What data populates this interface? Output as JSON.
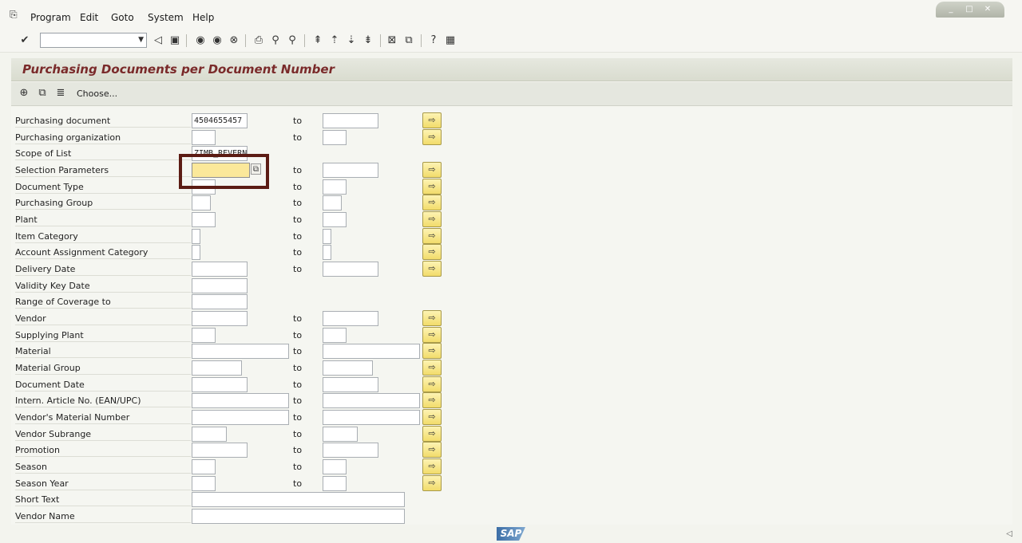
{
  "menu": {
    "items": [
      "Program",
      "Edit",
      "Goto",
      "System",
      "Help"
    ]
  },
  "window_controls": [
    "_",
    "□",
    "✕"
  ],
  "toolbar": {
    "command_field_value": ""
  },
  "screen": {
    "title": "Purchasing Documents per Document Number",
    "choose_label": "Choose..."
  },
  "fields": [
    {
      "label": "Purchasing document",
      "low": "4504655457",
      "to": "to",
      "high": "",
      "more": true
    },
    {
      "label": "Purchasing organization",
      "low": "",
      "to": "to",
      "high": "",
      "more": true
    },
    {
      "label": "Scope of List",
      "low": "ZIMB_REVERN",
      "to": "",
      "high": "",
      "more": false
    },
    {
      "label": "Selection Parameters",
      "low": "",
      "to": "to",
      "high": "",
      "more": true
    },
    {
      "label": "Document Type",
      "low": "",
      "to": "to",
      "high": "",
      "more": true
    },
    {
      "label": "Purchasing Group",
      "low": "",
      "to": "to",
      "high": "",
      "more": true
    },
    {
      "label": "Plant",
      "low": "",
      "to": "to",
      "high": "",
      "more": true
    },
    {
      "label": "Item Category",
      "low": "",
      "to": "to",
      "high": "",
      "more": true
    },
    {
      "label": "Account Assignment Category",
      "low": "",
      "to": "to",
      "high": "",
      "more": true
    },
    {
      "label": "Delivery Date",
      "low": "",
      "to": "to",
      "high": "",
      "more": true
    },
    {
      "label": "Validity Key Date",
      "low": "",
      "to": "",
      "high": "",
      "more": false
    },
    {
      "label": "Range of Coverage to",
      "low": "",
      "to": "",
      "high": "",
      "more": false
    },
    {
      "label": "Vendor",
      "low": "",
      "to": "to",
      "high": "",
      "more": true
    },
    {
      "label": "Supplying Plant",
      "low": "",
      "to": "to",
      "high": "",
      "more": true
    },
    {
      "label": "Material",
      "low": "",
      "to": "to",
      "high": "",
      "more": true
    },
    {
      "label": "Material Group",
      "low": "",
      "to": "to",
      "high": "",
      "more": true
    },
    {
      "label": "Document Date",
      "low": "",
      "to": "to",
      "high": "",
      "more": true
    },
    {
      "label": "Intern. Article No. (EAN/UPC)",
      "low": "",
      "to": "to",
      "high": "",
      "more": true
    },
    {
      "label": "Vendor's Material Number",
      "low": "",
      "to": "to",
      "high": "",
      "more": true
    },
    {
      "label": "Vendor Subrange",
      "low": "",
      "to": "to",
      "high": "",
      "more": true
    },
    {
      "label": "Promotion",
      "low": "",
      "to": "to",
      "high": "",
      "more": true
    },
    {
      "label": "Season",
      "low": "",
      "to": "to",
      "high": "",
      "more": true
    },
    {
      "label": "Season Year",
      "low": "",
      "to": "to",
      "high": "",
      "more": true
    },
    {
      "label": "Short Text",
      "low": "",
      "to": "",
      "high": "",
      "more": false
    },
    {
      "label": "Vendor Name",
      "low": "",
      "to": "",
      "high": "",
      "more": false
    }
  ],
  "status": {
    "logo": "SAP"
  },
  "colors": {
    "title": "#7a2a2a",
    "focus_field": "#fbe89a",
    "highlight_box": "#5c1c14",
    "more_button": "#f2dc6b"
  }
}
